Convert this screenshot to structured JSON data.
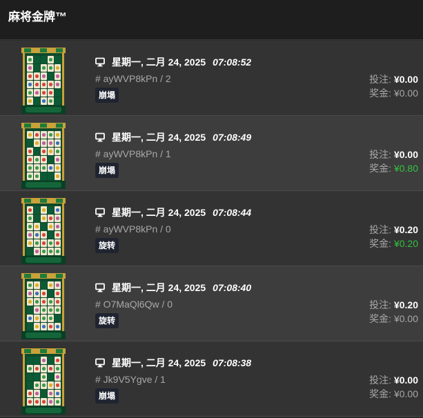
{
  "app": {
    "title": "麻将金牌™"
  },
  "labels": {
    "bet_label": "投注:",
    "win_label": "奖金:"
  },
  "colors": {
    "header_bg": "#1e1e1e",
    "positive_win": "#35c23f",
    "badge_bg": "#1f2430"
  },
  "rows": [
    {
      "date": "星期一, 二月 24, 2025",
      "time": "07:08:52",
      "session": "# ayWVP8kPn / 2",
      "tag": "崩塌",
      "bet": "¥0.00",
      "win": "¥0.00",
      "win_positive": false
    },
    {
      "date": "星期一, 二月 24, 2025",
      "time": "07:08:49",
      "session": "# ayWVP8kPn / 1",
      "tag": "崩塌",
      "bet": "¥0.00",
      "win": "¥0.80",
      "win_positive": true
    },
    {
      "date": "星期一, 二月 24, 2025",
      "time": "07:08:44",
      "session": "# ayWVP8kPn / 0",
      "tag": "旋转",
      "bet": "¥0.20",
      "win": "¥0.20",
      "win_positive": true
    },
    {
      "date": "星期一, 二月 24, 2025",
      "time": "07:08:40",
      "session": "# O7MaQl6Qw / 0",
      "tag": "旋转",
      "bet": "¥0.20",
      "win": "¥0.00",
      "win_positive": false
    },
    {
      "date": "星期一, 二月 24, 2025",
      "time": "07:08:38",
      "session": "# Jk9V5Ygve / 1",
      "tag": "崩塌",
      "bet": "¥0.00",
      "win": "¥0.00",
      "win_positive": false
    }
  ]
}
